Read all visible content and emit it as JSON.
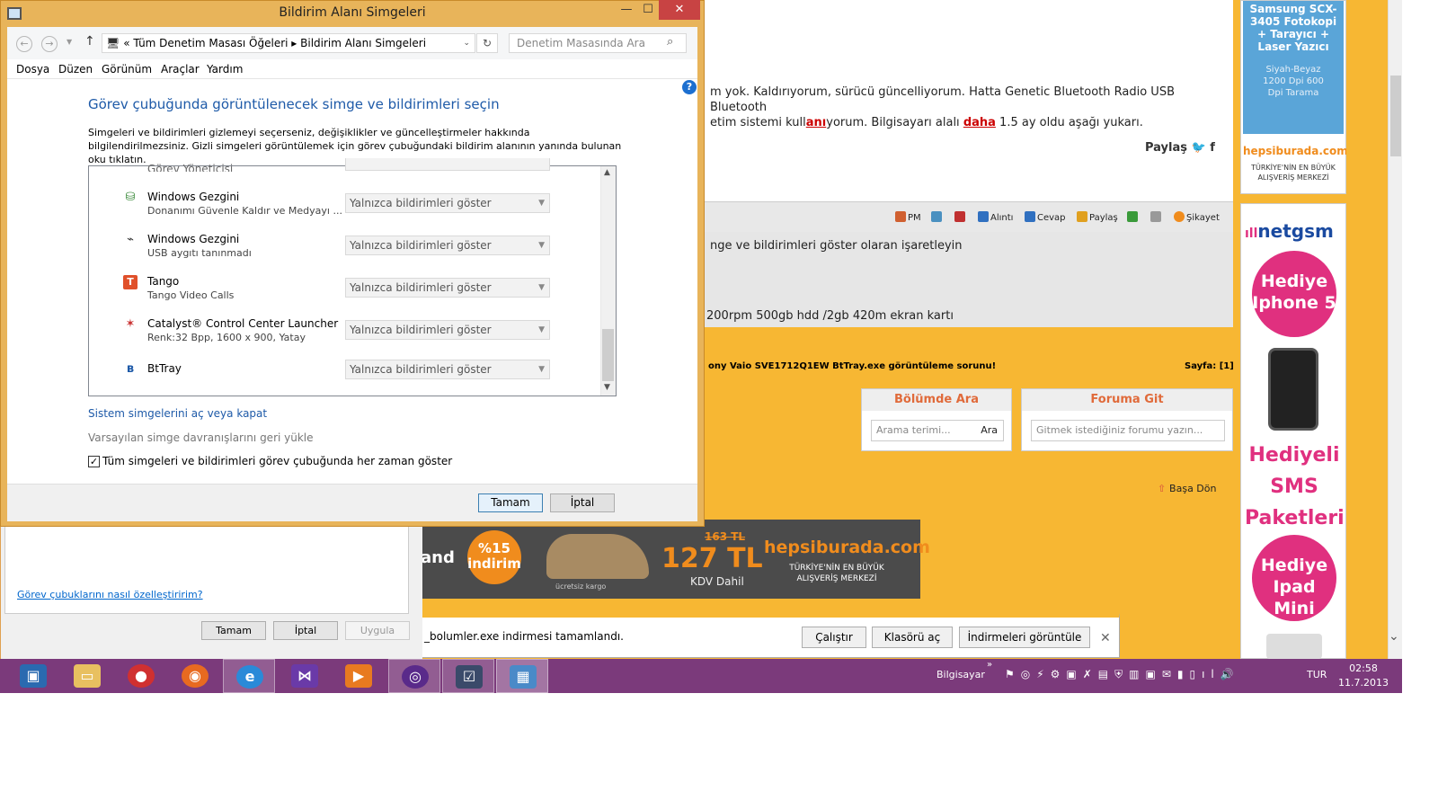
{
  "dialog": {
    "title": "Bildirim Alanı Simgeleri",
    "window_buttons": {
      "minimize": "—",
      "maximize": "☐",
      "close": "✕"
    },
    "address": "«  Tüm Denetim Masası Öğeleri  ▸  Bildirim Alanı Simgeleri",
    "search_placeholder": "Denetim Masasında Ara",
    "menu": [
      "Dosya",
      "Düzen",
      "Görünüm",
      "Araçlar",
      "Yardım"
    ],
    "heading": "Görev çubuğunda görüntülenecek simge ve bildirimleri seçin",
    "description": "Simgeleri ve bildirimleri gizlemeyi seçerseniz, değişiklikler ve güncelleştirmeler hakkında bilgilendirilmezsiniz. Gizli simgeleri görüntülemek için görev çubuğundaki bildirim alanının yanında bulunan oku tıklatın.",
    "rows": [
      {
        "name": "Görev Yöneticisi",
        "sub": "",
        "icon": "task-manager-icon",
        "behavior": ""
      },
      {
        "name": "Windows Gezgini",
        "sub": "Donanımı Güvenle Kaldır ve Medyayı ...",
        "icon": "safely-remove-icon",
        "behavior": "Yalnızca bildirimleri göster"
      },
      {
        "name": "Windows Gezgini",
        "sub": "USB aygıtı tanınmadı",
        "icon": "usb-icon",
        "behavior": "Yalnızca bildirimleri göster"
      },
      {
        "name": "Tango",
        "sub": "Tango Video Calls",
        "icon": "tango-icon",
        "behavior": "Yalnızca bildirimleri göster"
      },
      {
        "name": "Catalyst® Control Center Launcher",
        "sub": "Renk:32 Bpp, 1600 x 900, Yatay",
        "icon": "catalyst-icon",
        "behavior": "Yalnızca bildirimleri göster"
      },
      {
        "name": "BtTray",
        "sub": "",
        "icon": "bluetooth-icon",
        "behavior": "Yalnızca bildirimleri göster"
      }
    ],
    "link_system_icons": "Sistem simgelerini aç veya kapat",
    "link_restore": "Varsayılan simge davranışlarını geri yükle",
    "always_show_label": "Tüm simgeleri ve bildirimleri görev çubuğunda her zaman göster",
    "always_show_checked": "✓",
    "ok": "Tamam",
    "cancel": "İptal",
    "help": "?"
  },
  "back_dialog": {
    "link": "Görev çubuklarını nasıl özelleştiririm?",
    "ok": "Tamam",
    "cancel": "İptal",
    "apply": "Uygula"
  },
  "browser": {
    "post_line1": "m yok. Kaldırıyorum, sürücü güncelliyorum. Hatta Genetic Bluetooth Radio USB Bluetooth",
    "post_line2_a": "etim sistemi kull",
    "post_line2_b": "anı",
    "post_line2_c": "yorum. Bilgisayarı alalı ",
    "post_line2_d": "daha",
    "post_line2_e": " 1.5 ay oldu aşağı yukarı.",
    "share": "Paylaş  🐦  f",
    "toolbar": [
      "PM",
      "",
      "",
      "Alıntı",
      "Cevap",
      "Paylaş",
      "",
      "",
      "Şikayet"
    ],
    "reply_line1": "nge ve bildirimleri göster olaran işaretleyin",
    "reply_line2": "200rpm 500gb hdd /2gb 420m ekran kartı",
    "thread_title": "ony Vaio SVE1712Q1EW BtTray.exe görüntüleme sorunu!",
    "pager": "Sayfa: [1]",
    "search_panel": {
      "title": "Bölümde Ara",
      "placeholder": "Arama terimi...",
      "button": "Ara"
    },
    "forum_panel": {
      "title": "Foruma Git",
      "placeholder": "Gitmek istediğiniz forumu yazın..."
    },
    "back_to_top": "Başa Dön"
  },
  "ads": {
    "top_title": "Samsung SCX-3405 Fotokopi + Tarayıcı + Laser Yazıcı",
    "top_sub": "Siyah-Beyaz 1200 Dpi 600 Dpi Tarama",
    "top_brand": "hepsiburada.com",
    "top_brand_sub": "TÜRKİYE'NİN EN BÜYÜK ALIŞVERİŞ MERKEZİ",
    "netgsm": "netgsm",
    "gift1": "Hediye Iphone 5",
    "gift_sms": "Hediyeli SMS Paketleri",
    "gift2": "Hediye Ipad Mini",
    "banner": {
      "sand": "and",
      "discount": "%15 indirim",
      "old_price": "163 TL",
      "price": "127 TL",
      "kdv": "KDV Dahil",
      "brand": "hepsiburada.com",
      "brand_sub": "TÜRKİYE'NİN EN BÜYÜK ALIŞVERİŞ MERKEZİ",
      "cargo": "ücretsiz kargo"
    }
  },
  "download_bar": {
    "text": "_bolumler.exe indirmesi tamamlandı.",
    "run": "Çalıştır",
    "open_folder": "Klasörü aç",
    "view_downloads": "İndirmeleri görüntüle",
    "close": "✕"
  },
  "taskbar": {
    "apps": [
      "store-app-icon",
      "file-explorer-icon",
      "media-app-icon",
      "firefox-icon",
      "internet-explorer-icon",
      "visual-studio-icon",
      "media-player-icon",
      "tango-app-icon",
      "task-list-icon",
      "control-panel-icon"
    ],
    "toolbar_label": "Bilgisayar",
    "language": "TUR",
    "time": "02:58",
    "date": "11.7.2013"
  },
  "colors": {
    "accent_orange": "#f7b733",
    "taskbar": "#7b3a7b",
    "heading_blue": "#1e5aa8",
    "close_red": "#c84343"
  }
}
